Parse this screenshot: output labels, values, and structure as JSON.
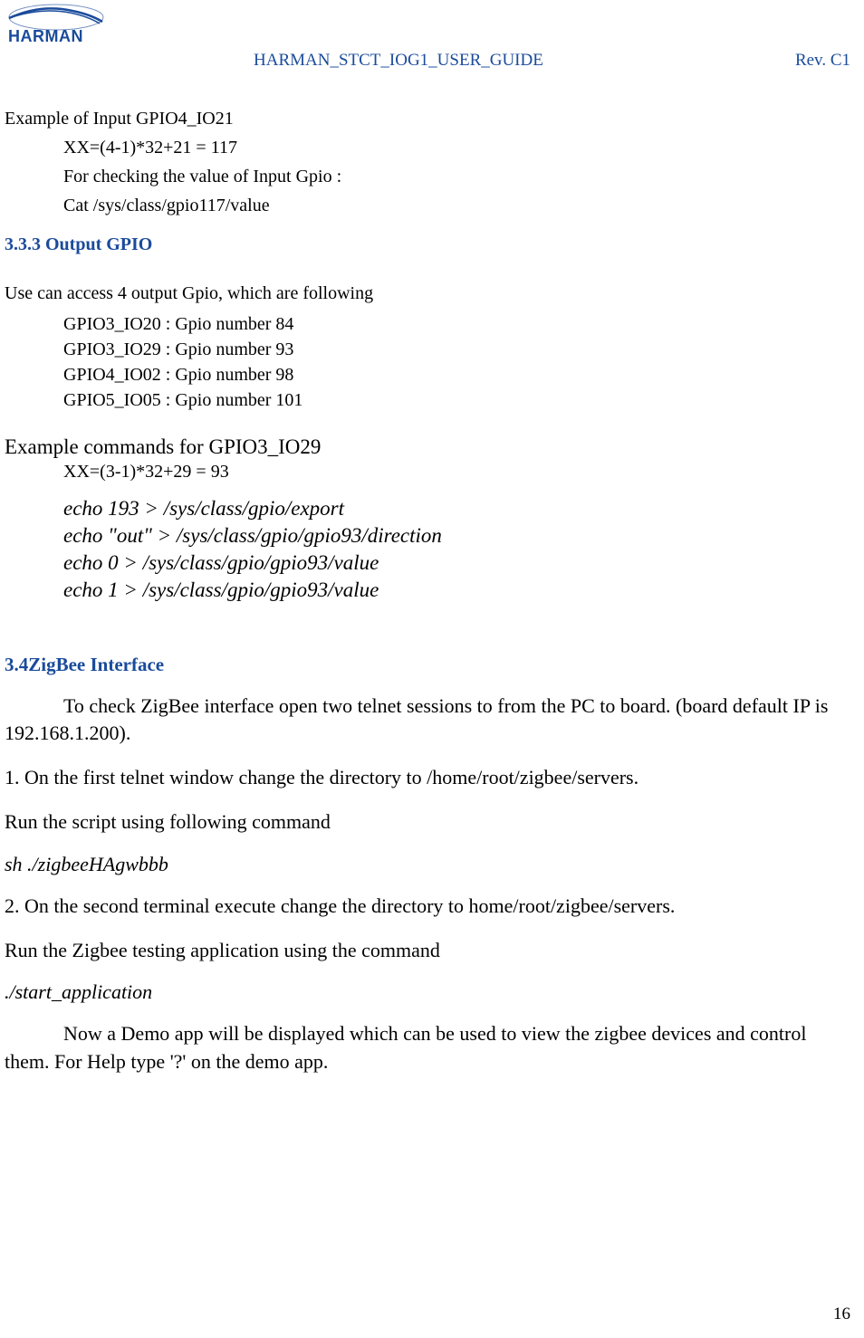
{
  "header": {
    "logo_text": "HARMAN",
    "doc_title": "HARMAN_STCT_IOG1_USER_GUIDE",
    "revision": "Rev. C1"
  },
  "body": {
    "example_input_title": "Example of Input GPIO4_IO21",
    "xx_calc": "XX=(4-1)*32+21 = 117",
    "check_value": "For checking the value of Input Gpio :",
    "cat_cmd": "Cat /sys/class/gpio117/value",
    "section_333": "3.3.3 Output GPIO",
    "output_intro": "Use can access 4 output Gpio, which are following",
    "gpio_list": {
      "g1": "GPIO3_IO20 : Gpio number 84",
      "g2": "GPIO3_IO29 : Gpio number 93",
      "g3": "GPIO4_IO02 : Gpio number 98",
      "g4": "GPIO5_IO05 : Gpio number 101"
    },
    "example_cmds_title": "Example commands for GPIO3_IO29",
    "xx_calc2": "XX=(3-1)*32+29 = 93",
    "echo1": "echo 193 > /sys/class/gpio/export",
    "echo2": "echo \"out\" > /sys/class/gpio/gpio93/direction",
    "echo3": "echo 0 > /sys/class/gpio/gpio93/value",
    "echo4": "echo 1 > /sys/class/gpio/gpio93/value",
    "section_34": "3.4ZigBee Interface",
    "zigbee_intro": "To check ZigBee interface open two telnet sessions to from the PC to board. (board default IP is 192.168.1.200).",
    "step1": "1. On the first telnet window change the directory to /home/root/zigbee/servers.",
    "run_script": "Run the script using following command",
    "sh_cmd": "sh ./zigbeeHAgwbbb",
    "step2": "2. On the second terminal execute change the directory to home/root/zigbee/servers.",
    "run_app": "Run the Zigbee testing application using the command",
    "start_cmd": "./start_application",
    "demo_app": "Now a Demo app will be displayed which can be used to view the zigbee devices and control them. For Help type '?' on the demo app."
  },
  "footer": {
    "page_number": "16"
  }
}
